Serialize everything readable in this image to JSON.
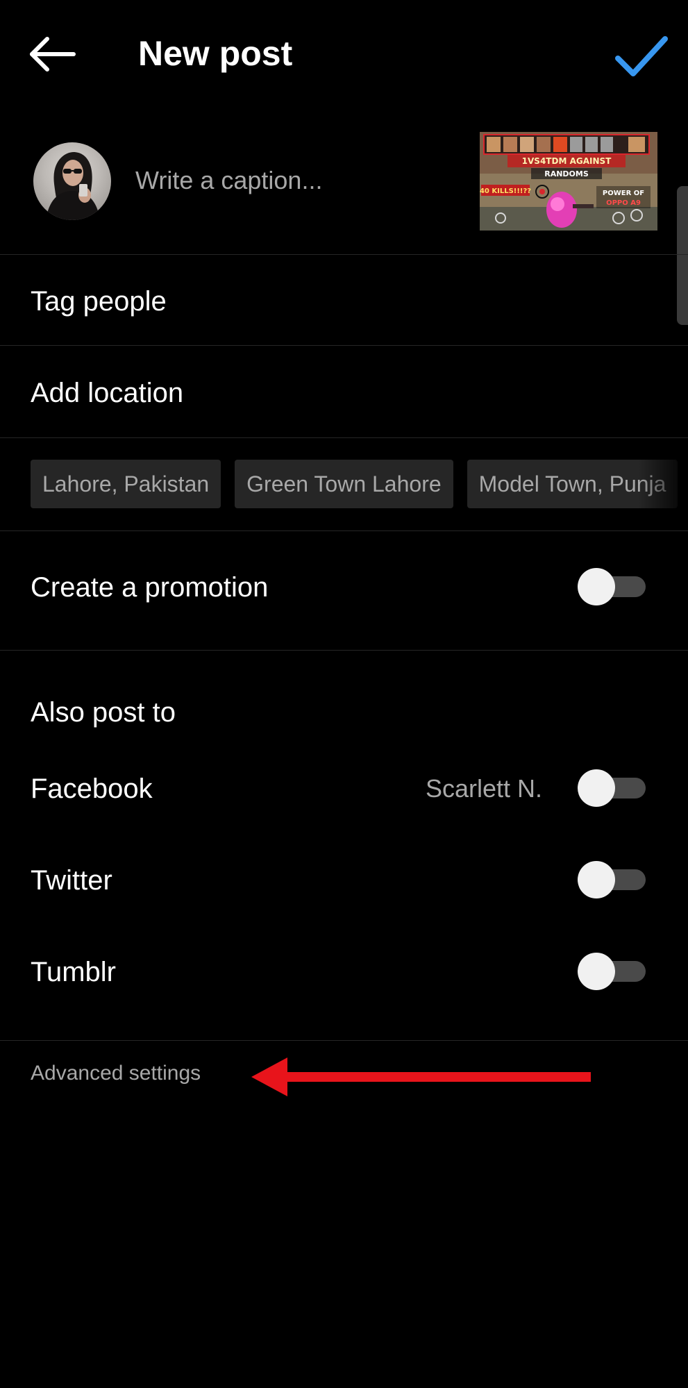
{
  "header": {
    "title": "New post",
    "back_icon": "arrow-left-icon",
    "confirm_icon": "checkmark-icon",
    "confirm_color": "#3897f0"
  },
  "caption": {
    "placeholder": "Write a caption...",
    "value": "",
    "thumbnail": {
      "line1": "1VS4TDM AGAINST",
      "line2": "RANDOMS",
      "line3": "40 KILLS!!!??",
      "line4": "POWER OF",
      "line5": "OPPO A9"
    }
  },
  "rows": {
    "tag_people": "Tag people",
    "add_location": "Add location"
  },
  "locations": [
    "Lahore, Pakistan",
    "Green Town Lahore",
    "Model Town, Punja"
  ],
  "promotion": {
    "label": "Create a promotion",
    "enabled": false
  },
  "share": {
    "title": "Also post to",
    "targets": [
      {
        "label": "Facebook",
        "account": "Scarlett N.",
        "enabled": false
      },
      {
        "label": "Twitter",
        "account": "",
        "enabled": false
      },
      {
        "label": "Tumblr",
        "account": "",
        "enabled": false
      }
    ]
  },
  "advanced_settings": "Advanced settings",
  "annotation": {
    "arrow_color": "#e8141b"
  },
  "colors": {
    "background": "#000000",
    "divider": "#262626",
    "secondary_text": "#a8a8a8",
    "chip_bg": "#262626",
    "toggle_track": "#4a4a4a",
    "toggle_knob": "#f1f1f1"
  }
}
